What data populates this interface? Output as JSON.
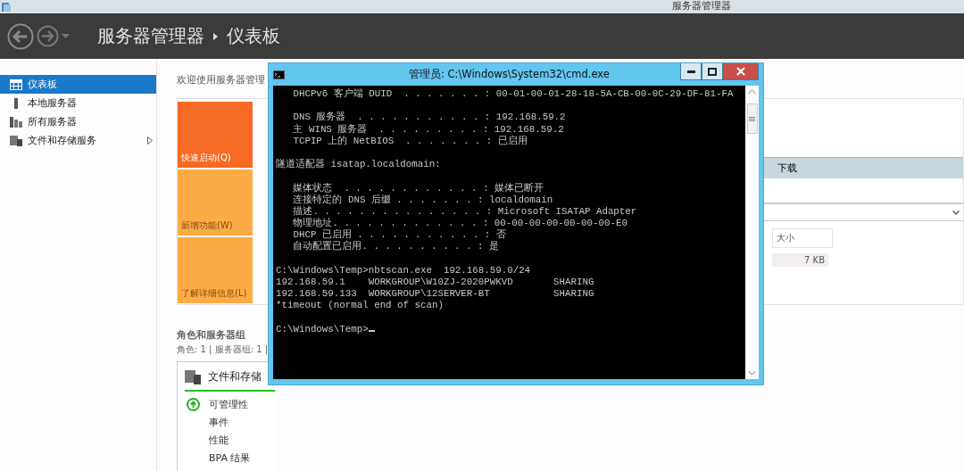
{
  "titlebar": {
    "title": "服务器管理器"
  },
  "header": {
    "breadcrumb": [
      "服务器管理器",
      "仪表板"
    ]
  },
  "sidebar": {
    "items": [
      {
        "label": "仪表板",
        "kind": "dashboard",
        "selected": true,
        "expandable": false
      },
      {
        "label": "本地服务器",
        "kind": "server",
        "selected": false,
        "expandable": false
      },
      {
        "label": "所有服务器",
        "kind": "servers",
        "selected": false,
        "expandable": false
      },
      {
        "label": "文件和存储服务",
        "kind": "storage",
        "selected": false,
        "expandable": true
      }
    ]
  },
  "welcome": {
    "heading": "欢迎使用服务器管理",
    "tiles": [
      {
        "label": "快速启动(Q)",
        "selected": true
      },
      {
        "label": "新增功能(W)",
        "selected": false
      },
      {
        "label": "了解详细信息(L)",
        "selected": false
      }
    ]
  },
  "downloads": {
    "header": "下载",
    "columns": [
      "大小"
    ],
    "rows": [
      [
        "7 KB"
      ]
    ]
  },
  "roles": {
    "heading": "角色和服务器组",
    "summary": "角色: 1 | 服务器组: 1 |",
    "cards": [
      {
        "title": "文件和存储",
        "rows": [
          {
            "label": "可管理性",
            "healthy": true
          },
          {
            "label": "事件",
            "healthy": false
          },
          {
            "label": "性能",
            "healthy": false
          },
          {
            "label": "BPA 结果",
            "healthy": false
          }
        ]
      }
    ]
  },
  "cmd": {
    "title": "管理员: C:\\Windows\\System32\\cmd.exe",
    "cursor": true,
    "blocks": [
      [
        "   DHCPv6 客户端 DUID  . . . . . . . : 00-01-00-01-28-18-5A-CB-00-0C-29-DF-81-FA"
      ],
      [
        "   DNS 服务器  . . . . . . . . . . . : 192.168.59.2",
        "   主 WINS 服务器  . . . . . . . . . : 192.168.59.2",
        "   TCPIP 上的 NetBIOS  . . . . . . . : 已启用"
      ],
      [
        "隧道适配器 isatap.localdomain:"
      ],
      [
        "   媒体状态  . . . . . . . . . . . . : 媒体已断开",
        "   连接特定的 DNS 后缀 . . . . . . . : localdomain",
        "   描述. . . . . . . . . . . . . . . : Microsoft ISATAP Adapter",
        "   物理地址. . . . . . . . . . . . . : 00-00-00-00-00-00-00-E0",
        "   DHCP 已启用 . . . . . . . . . . . : 否",
        "   自动配置已启用. . . . . . . . . . : 是"
      ],
      [
        "C:\\Windows\\Temp>nbtscan.exe  192.168.59.0/24",
        "192.168.59.1    WORKGROUP\\W10ZJ-2020PWKVD       SHARING",
        "192.168.59.133  WORKGROUP\\12SERVER-BT           SHARING",
        "*timeout (normal end of scan)"
      ],
      [
        "C:\\Windows\\Temp>"
      ]
    ]
  }
}
